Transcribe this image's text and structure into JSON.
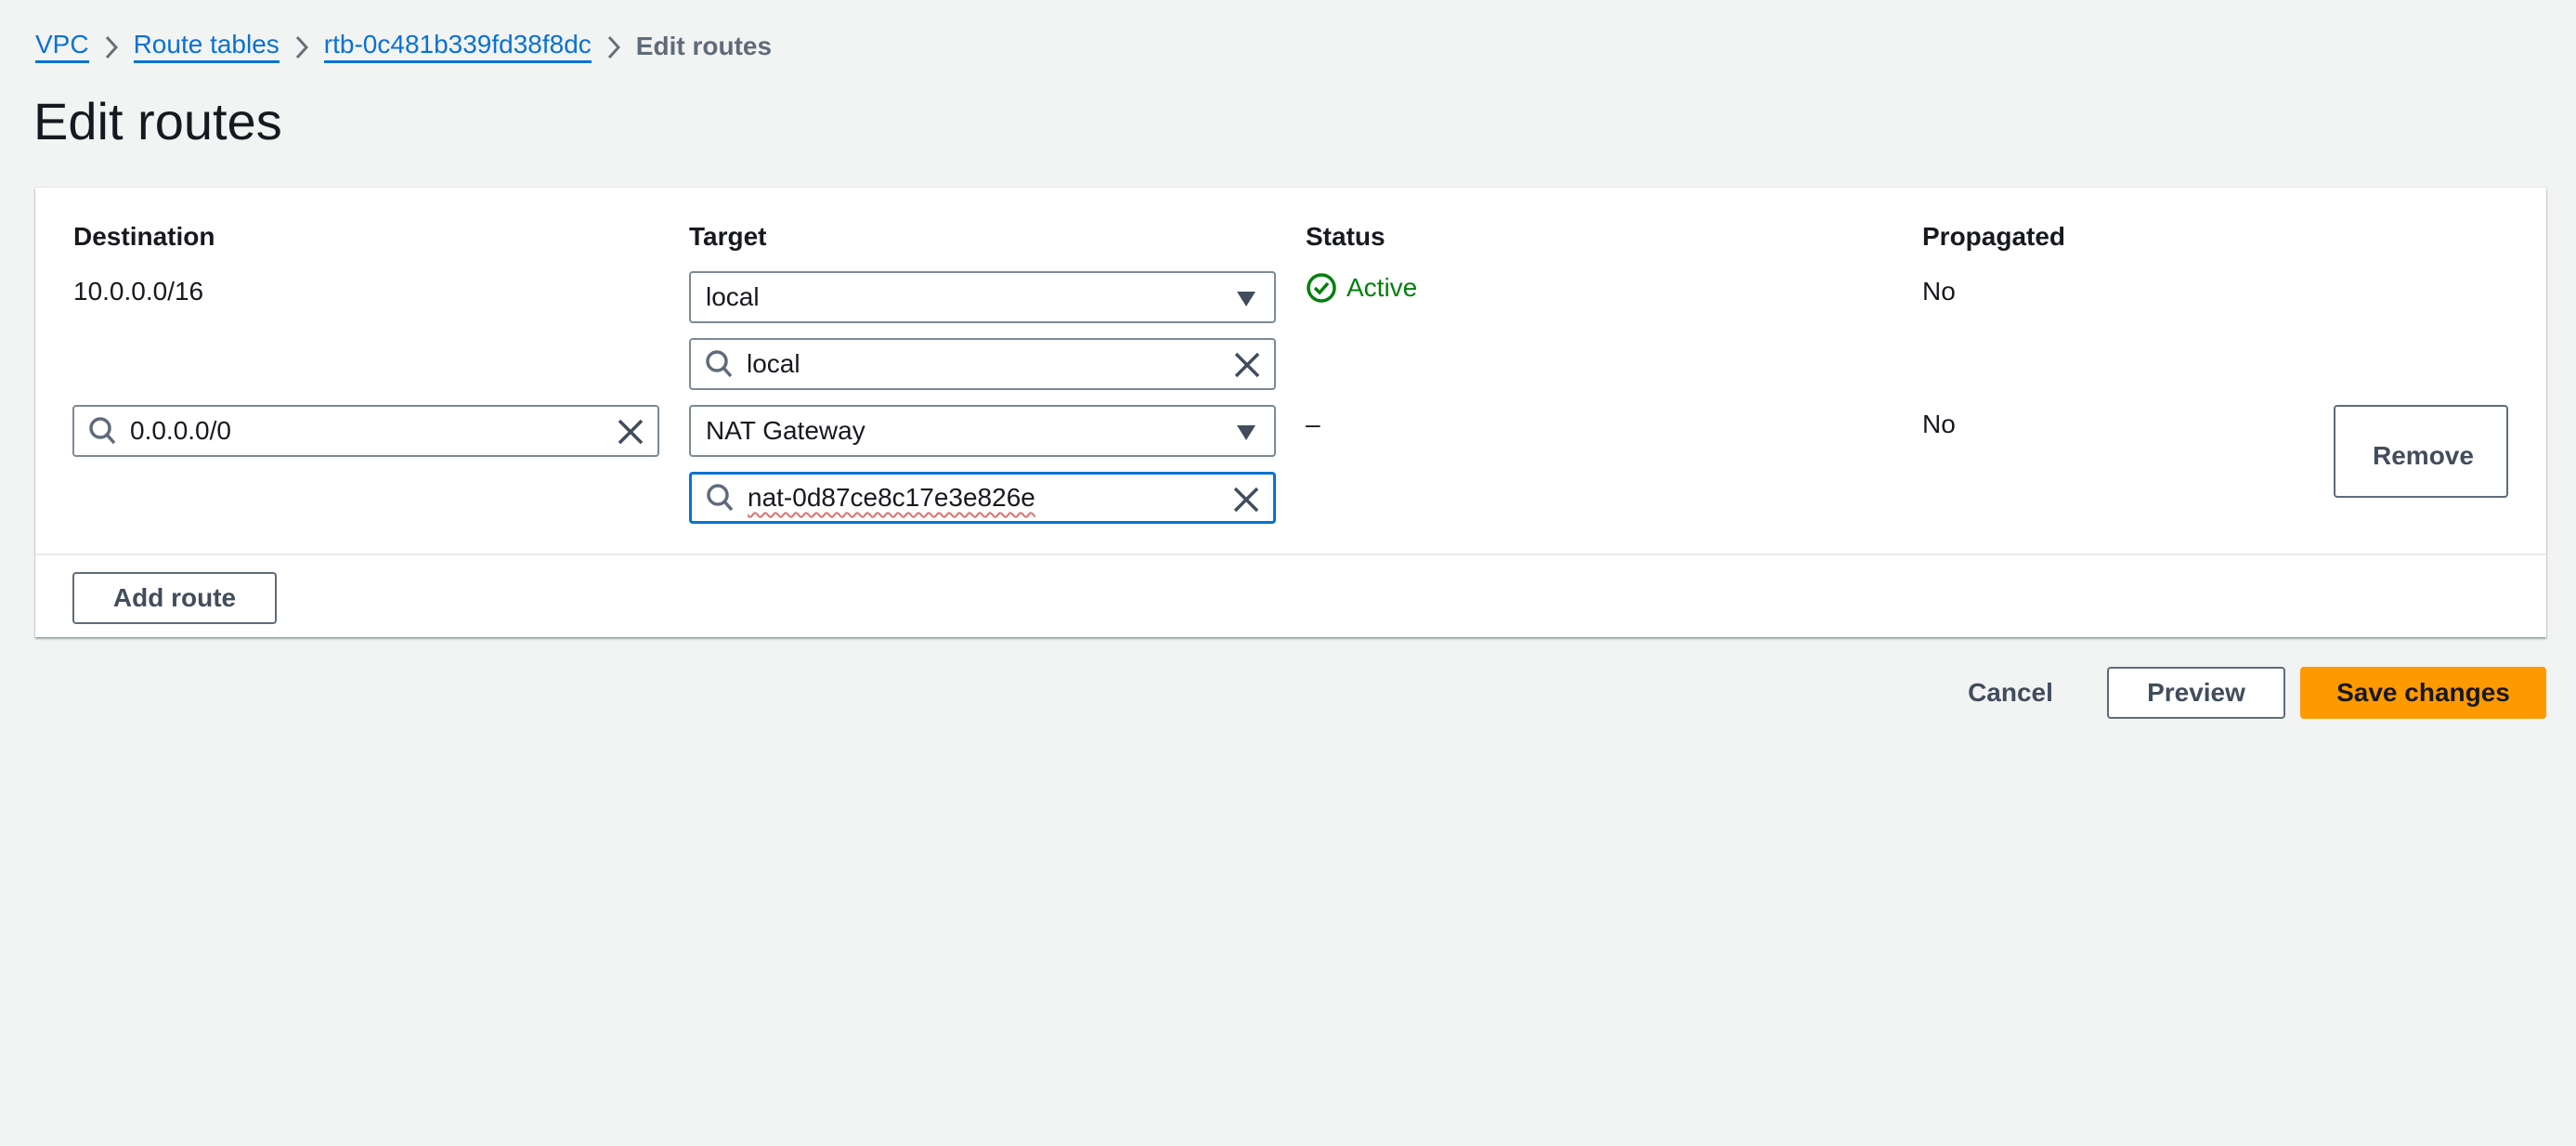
{
  "breadcrumb": {
    "items": [
      {
        "label": "VPC"
      },
      {
        "label": "Route tables"
      },
      {
        "label": "rtb-0c481b339fd38f8dc"
      }
    ],
    "current": "Edit routes"
  },
  "page": {
    "title": "Edit routes"
  },
  "table": {
    "headers": {
      "destination": "Destination",
      "target": "Target",
      "status": "Status",
      "propagated": "Propagated"
    },
    "rows": [
      {
        "destination": "10.0.0.0/16",
        "target_type": "local",
        "target_search": "local",
        "status": "Active",
        "propagated": "No"
      },
      {
        "destination": "0.0.0.0/0",
        "target_type": "NAT Gateway",
        "target_search": "nat-0d87ce8c17e3e826e",
        "status": "–",
        "propagated": "No",
        "remove_label": "Remove"
      }
    ],
    "add_route_label": "Add route"
  },
  "footer": {
    "cancel_label": "Cancel",
    "preview_label": "Preview",
    "save_label": "Save changes"
  },
  "colors": {
    "link": "#0972d3",
    "status_active": "#037f0c",
    "primary": "#ff9900",
    "focus": "#0972d3"
  },
  "icons": {
    "breadcrumb_separator": "chevron-right-icon",
    "search": "search-icon",
    "clear": "close-icon",
    "dropdown": "caret-down-icon",
    "status_ok": "status-positive-icon"
  }
}
